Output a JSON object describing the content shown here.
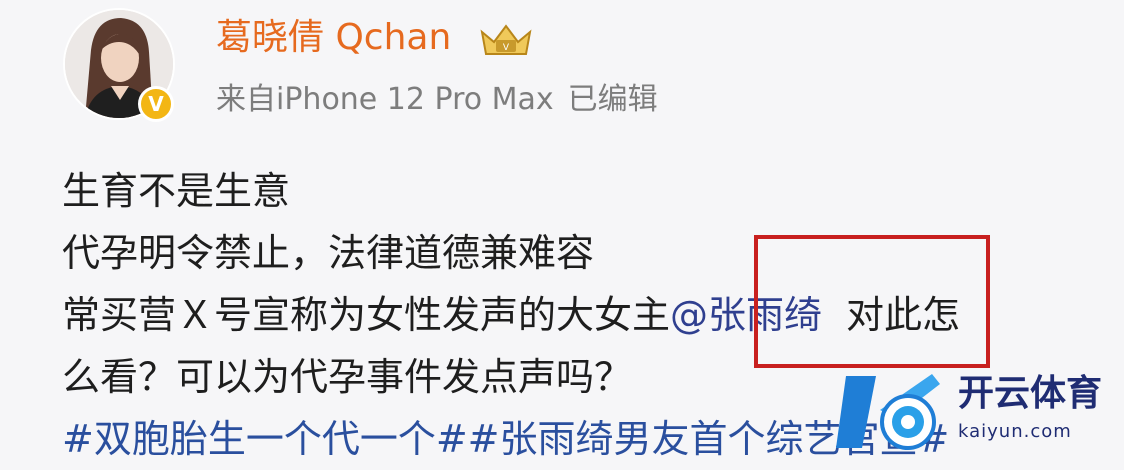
{
  "post": {
    "author": {
      "name": "葛晓倩 Qchan",
      "avatar_icon": "profile-avatar",
      "verified_icon": "verified-v-icon",
      "badge_icon": "crown-badge-icon"
    },
    "meta": {
      "source": "来自iPhone 12 Pro Max",
      "edited": "已编辑"
    },
    "body": {
      "line1": "生育不是生意",
      "line2": "代孕明令禁止，法律道德兼难容",
      "line3_before": "常买营Ｘ号宣称为女性发声的大女主",
      "line3_mention": "@张雨绮",
      "line3_after": "对此怎",
      "line4": "么看？可以为代孕事件发点声吗？",
      "line5_tags": "#双胞胎生一个代一个##张雨绮男友首个综艺官宣#"
    }
  },
  "watermark": {
    "name": "开云体育",
    "domain": "kaiyun.com"
  },
  "colors": {
    "username": "#e66a1f",
    "meta": "#7d7d7d",
    "mention": "#2f3f8f",
    "hashtag": "#2a4f9e",
    "highlight_box": "#c8201f",
    "watermark": "#1f2c73"
  }
}
